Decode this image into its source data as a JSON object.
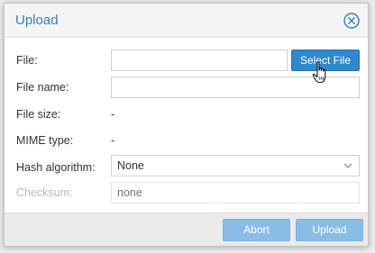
{
  "dialog": {
    "title": "Upload"
  },
  "form": {
    "file_label": "File:",
    "file_value": "",
    "select_file_label": "Select File",
    "file_name_label": "File name:",
    "file_name_value": "",
    "file_size_label": "File size:",
    "file_size_value": "-",
    "mime_type_label": "MIME type:",
    "mime_type_value": "-",
    "hash_algorithm_label": "Hash algorithm:",
    "hash_algorithm_value": "None",
    "checksum_label": "Checksum:",
    "checksum_placeholder": "none"
  },
  "footer": {
    "abort_label": "Abort",
    "upload_label": "Upload"
  },
  "colors": {
    "title": "#2f7fbd",
    "primary_button": "#3089ce",
    "disabled_button": "#89bde6"
  },
  "icons": {
    "close": "close-circle-x-icon",
    "dropdown": "chevron-down-icon",
    "pointer": "hand-pointer-cursor-icon"
  }
}
